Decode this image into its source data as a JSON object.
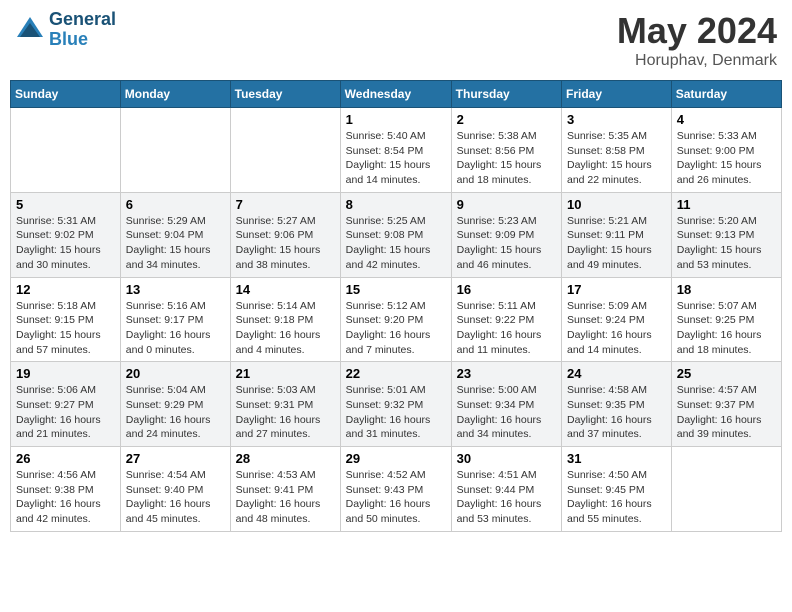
{
  "header": {
    "logo_line1": "General",
    "logo_line2": "Blue",
    "month": "May 2024",
    "location": "Horuphav, Denmark"
  },
  "weekdays": [
    "Sunday",
    "Monday",
    "Tuesday",
    "Wednesday",
    "Thursday",
    "Friday",
    "Saturday"
  ],
  "weeks": [
    [
      {
        "day": "",
        "sunrise": "",
        "sunset": "",
        "daylight": ""
      },
      {
        "day": "",
        "sunrise": "",
        "sunset": "",
        "daylight": ""
      },
      {
        "day": "",
        "sunrise": "",
        "sunset": "",
        "daylight": ""
      },
      {
        "day": "1",
        "sunrise": "Sunrise: 5:40 AM",
        "sunset": "Sunset: 8:54 PM",
        "daylight": "Daylight: 15 hours and 14 minutes."
      },
      {
        "day": "2",
        "sunrise": "Sunrise: 5:38 AM",
        "sunset": "Sunset: 8:56 PM",
        "daylight": "Daylight: 15 hours and 18 minutes."
      },
      {
        "day": "3",
        "sunrise": "Sunrise: 5:35 AM",
        "sunset": "Sunset: 8:58 PM",
        "daylight": "Daylight: 15 hours and 22 minutes."
      },
      {
        "day": "4",
        "sunrise": "Sunrise: 5:33 AM",
        "sunset": "Sunset: 9:00 PM",
        "daylight": "Daylight: 15 hours and 26 minutes."
      }
    ],
    [
      {
        "day": "5",
        "sunrise": "Sunrise: 5:31 AM",
        "sunset": "Sunset: 9:02 PM",
        "daylight": "Daylight: 15 hours and 30 minutes."
      },
      {
        "day": "6",
        "sunrise": "Sunrise: 5:29 AM",
        "sunset": "Sunset: 9:04 PM",
        "daylight": "Daylight: 15 hours and 34 minutes."
      },
      {
        "day": "7",
        "sunrise": "Sunrise: 5:27 AM",
        "sunset": "Sunset: 9:06 PM",
        "daylight": "Daylight: 15 hours and 38 minutes."
      },
      {
        "day": "8",
        "sunrise": "Sunrise: 5:25 AM",
        "sunset": "Sunset: 9:08 PM",
        "daylight": "Daylight: 15 hours and 42 minutes."
      },
      {
        "day": "9",
        "sunrise": "Sunrise: 5:23 AM",
        "sunset": "Sunset: 9:09 PM",
        "daylight": "Daylight: 15 hours and 46 minutes."
      },
      {
        "day": "10",
        "sunrise": "Sunrise: 5:21 AM",
        "sunset": "Sunset: 9:11 PM",
        "daylight": "Daylight: 15 hours and 49 minutes."
      },
      {
        "day": "11",
        "sunrise": "Sunrise: 5:20 AM",
        "sunset": "Sunset: 9:13 PM",
        "daylight": "Daylight: 15 hours and 53 minutes."
      }
    ],
    [
      {
        "day": "12",
        "sunrise": "Sunrise: 5:18 AM",
        "sunset": "Sunset: 9:15 PM",
        "daylight": "Daylight: 15 hours and 57 minutes."
      },
      {
        "day": "13",
        "sunrise": "Sunrise: 5:16 AM",
        "sunset": "Sunset: 9:17 PM",
        "daylight": "Daylight: 16 hours and 0 minutes."
      },
      {
        "day": "14",
        "sunrise": "Sunrise: 5:14 AM",
        "sunset": "Sunset: 9:18 PM",
        "daylight": "Daylight: 16 hours and 4 minutes."
      },
      {
        "day": "15",
        "sunrise": "Sunrise: 5:12 AM",
        "sunset": "Sunset: 9:20 PM",
        "daylight": "Daylight: 16 hours and 7 minutes."
      },
      {
        "day": "16",
        "sunrise": "Sunrise: 5:11 AM",
        "sunset": "Sunset: 9:22 PM",
        "daylight": "Daylight: 16 hours and 11 minutes."
      },
      {
        "day": "17",
        "sunrise": "Sunrise: 5:09 AM",
        "sunset": "Sunset: 9:24 PM",
        "daylight": "Daylight: 16 hours and 14 minutes."
      },
      {
        "day": "18",
        "sunrise": "Sunrise: 5:07 AM",
        "sunset": "Sunset: 9:25 PM",
        "daylight": "Daylight: 16 hours and 18 minutes."
      }
    ],
    [
      {
        "day": "19",
        "sunrise": "Sunrise: 5:06 AM",
        "sunset": "Sunset: 9:27 PM",
        "daylight": "Daylight: 16 hours and 21 minutes."
      },
      {
        "day": "20",
        "sunrise": "Sunrise: 5:04 AM",
        "sunset": "Sunset: 9:29 PM",
        "daylight": "Daylight: 16 hours and 24 minutes."
      },
      {
        "day": "21",
        "sunrise": "Sunrise: 5:03 AM",
        "sunset": "Sunset: 9:31 PM",
        "daylight": "Daylight: 16 hours and 27 minutes."
      },
      {
        "day": "22",
        "sunrise": "Sunrise: 5:01 AM",
        "sunset": "Sunset: 9:32 PM",
        "daylight": "Daylight: 16 hours and 31 minutes."
      },
      {
        "day": "23",
        "sunrise": "Sunrise: 5:00 AM",
        "sunset": "Sunset: 9:34 PM",
        "daylight": "Daylight: 16 hours and 34 minutes."
      },
      {
        "day": "24",
        "sunrise": "Sunrise: 4:58 AM",
        "sunset": "Sunset: 9:35 PM",
        "daylight": "Daylight: 16 hours and 37 minutes."
      },
      {
        "day": "25",
        "sunrise": "Sunrise: 4:57 AM",
        "sunset": "Sunset: 9:37 PM",
        "daylight": "Daylight: 16 hours and 39 minutes."
      }
    ],
    [
      {
        "day": "26",
        "sunrise": "Sunrise: 4:56 AM",
        "sunset": "Sunset: 9:38 PM",
        "daylight": "Daylight: 16 hours and 42 minutes."
      },
      {
        "day": "27",
        "sunrise": "Sunrise: 4:54 AM",
        "sunset": "Sunset: 9:40 PM",
        "daylight": "Daylight: 16 hours and 45 minutes."
      },
      {
        "day": "28",
        "sunrise": "Sunrise: 4:53 AM",
        "sunset": "Sunset: 9:41 PM",
        "daylight": "Daylight: 16 hours and 48 minutes."
      },
      {
        "day": "29",
        "sunrise": "Sunrise: 4:52 AM",
        "sunset": "Sunset: 9:43 PM",
        "daylight": "Daylight: 16 hours and 50 minutes."
      },
      {
        "day": "30",
        "sunrise": "Sunrise: 4:51 AM",
        "sunset": "Sunset: 9:44 PM",
        "daylight": "Daylight: 16 hours and 53 minutes."
      },
      {
        "day": "31",
        "sunrise": "Sunrise: 4:50 AM",
        "sunset": "Sunset: 9:45 PM",
        "daylight": "Daylight: 16 hours and 55 minutes."
      },
      {
        "day": "",
        "sunrise": "",
        "sunset": "",
        "daylight": ""
      }
    ]
  ]
}
